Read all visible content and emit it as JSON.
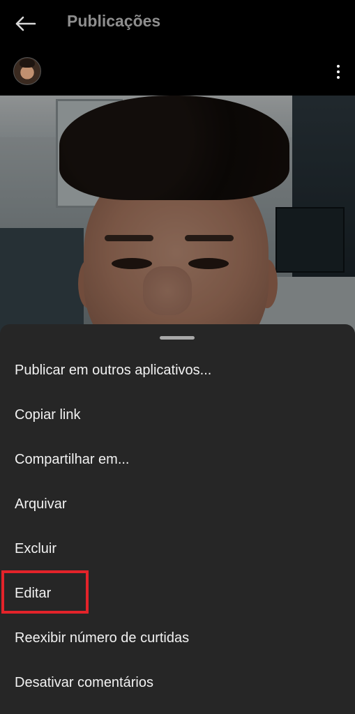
{
  "header": {
    "title": "Publicações",
    "back_icon": "arrow-left-icon",
    "more_icon": "more-vertical-icon"
  },
  "post": {
    "avatar_icon": "profile-avatar",
    "image_description_icon": "selfie-photo"
  },
  "menu": {
    "items": [
      {
        "label": "Publicar em outros aplicativos..."
      },
      {
        "label": "Copiar link"
      },
      {
        "label": "Compartilhar em..."
      },
      {
        "label": "Arquivar"
      },
      {
        "label": "Excluir"
      },
      {
        "label": "Editar",
        "highlighted": true
      },
      {
        "label": "Reexibir número de curtidas"
      },
      {
        "label": "Desativar comentários"
      }
    ]
  },
  "colors": {
    "background": "#000000",
    "sheet": "#262626",
    "title": "#8e8e8e",
    "highlight_box": "#e3232a"
  }
}
